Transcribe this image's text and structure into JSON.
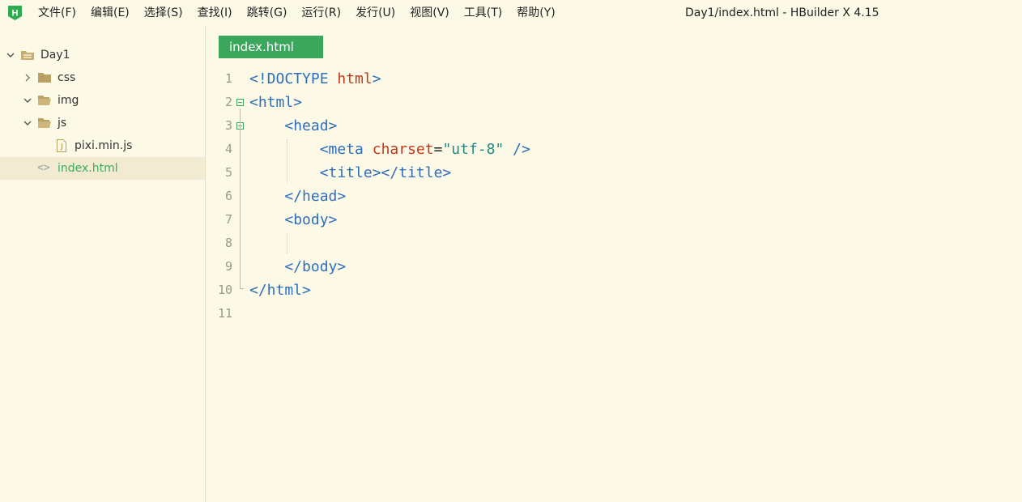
{
  "titlebar": {
    "menu": [
      "文件(F)",
      "编辑(E)",
      "选择(S)",
      "查找(I)",
      "跳转(G)",
      "运行(R)",
      "发行(U)",
      "视图(V)",
      "工具(T)",
      "帮助(Y)"
    ],
    "window_title": "Day1/index.html - HBuilder X 4.15",
    "logo_letter": "H"
  },
  "sidebar": {
    "project": "Day1",
    "items": [
      {
        "label": "css",
        "icon": "folder-closed-icon",
        "expanded": false
      },
      {
        "label": "img",
        "icon": "folder-open-icon",
        "expanded": true
      },
      {
        "label": "js",
        "icon": "folder-open-icon",
        "expanded": true
      },
      {
        "label": "pixi.min.js",
        "icon": "js-file-icon"
      },
      {
        "label": "index.html",
        "icon": "html-file-icon",
        "selected": true
      }
    ]
  },
  "editor": {
    "active_tab": "index.html",
    "line_numbers": [
      "1",
      "2",
      "3",
      "4",
      "5",
      "6",
      "7",
      "8",
      "9",
      "10",
      "11"
    ],
    "lines": [
      [
        [
          "t-tag",
          "<!DOCTYPE "
        ],
        [
          "t-attr",
          "html"
        ],
        [
          "t-tag",
          ">"
        ]
      ],
      [
        [
          "t-tag",
          "<html>"
        ]
      ],
      [
        [
          "t-plain",
          "    "
        ],
        [
          "t-tag",
          "<head>"
        ]
      ],
      [
        [
          "t-plain",
          "        "
        ],
        [
          "t-tag",
          "<meta "
        ],
        [
          "t-attr",
          "charset"
        ],
        [
          "t-plain",
          "="
        ],
        [
          "t-str",
          "\"utf-8\""
        ],
        [
          "t-plain",
          " "
        ],
        [
          "t-tag",
          "/>"
        ]
      ],
      [
        [
          "t-plain",
          "        "
        ],
        [
          "t-tag",
          "<title></title>"
        ]
      ],
      [
        [
          "t-plain",
          "    "
        ],
        [
          "t-tag",
          "</head>"
        ]
      ],
      [
        [
          "t-plain",
          "    "
        ],
        [
          "t-tag",
          "<body>"
        ]
      ],
      [],
      [
        [
          "t-plain",
          "    "
        ],
        [
          "t-tag",
          "</body>"
        ]
      ],
      [
        [
          "t-tag",
          "</html>"
        ]
      ],
      []
    ],
    "colors": {
      "tag": "#2D6EBF",
      "attr": "#C0391D",
      "string": "#208A83",
      "tab_bg": "#3BA75D",
      "selected_file": "#3BAE5E"
    }
  }
}
